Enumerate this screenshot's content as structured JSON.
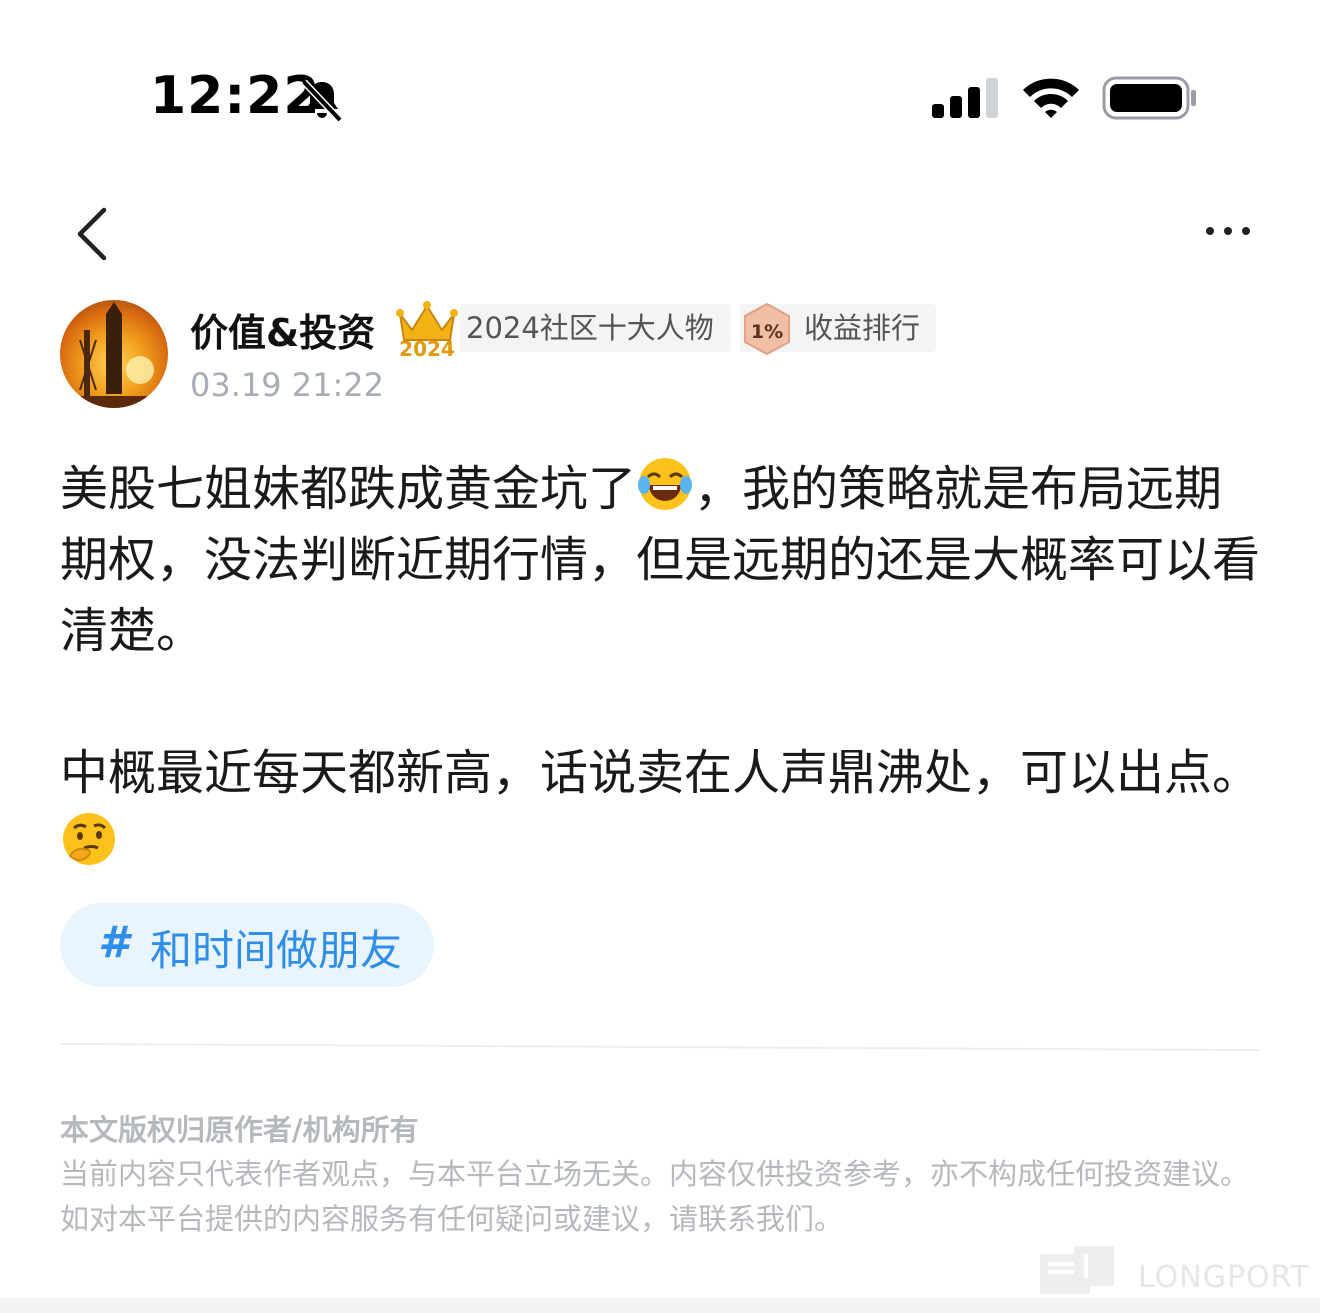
{
  "status_bar": {
    "time": "12:22",
    "icons": [
      "bell-slash-icon",
      "cellular-signal-icon",
      "wifi-icon",
      "battery-icon"
    ]
  },
  "nav": {
    "back_icon": "chevron-left-icon",
    "more_icon": "more-horizontal-icon"
  },
  "author": {
    "name": "价值&投资",
    "crown_icon": "crown-2024-icon",
    "crown_text": "2024",
    "badge_top_label": "2024社区十大人物",
    "rank_icon": "rank-1-percent-icon",
    "rank_icon_text": "1%",
    "badge_rank_label": "收益排行",
    "post_time": "03.19 21:22"
  },
  "post": {
    "paragraph1_part1": "美股七姐妹都跌成黄金坑了",
    "paragraph1_emoji": "tears-of-joy-emoji",
    "paragraph1_part2": "，我的策略就是布局远期期权，没法判断近期行情，但是远期的还是大概率可以看清楚。",
    "paragraph2_text": "中概最近每天都新高，话说卖在人声鼎沸处，可以出点。",
    "paragraph2_emoji": "thinking-face-emoji"
  },
  "topic": {
    "hash": "#",
    "label": "和时间做朋友"
  },
  "disclaimer": {
    "title": "本文版权归原作者/机构所有",
    "text": "当前内容只代表作者观点，与本平台立场无关。内容仅供投资参考，亦不构成任何投资建议。如对本平台提供的内容服务有任何疑问或建议，请联系我们。"
  },
  "watermark": {
    "text": "LONGPORT"
  },
  "colors": {
    "accent_blue": "#2e8ee8",
    "tag_bg": "#eaf4fd",
    "muted_text": "#a8adb4",
    "badge_bg": "#f3f4f6"
  }
}
